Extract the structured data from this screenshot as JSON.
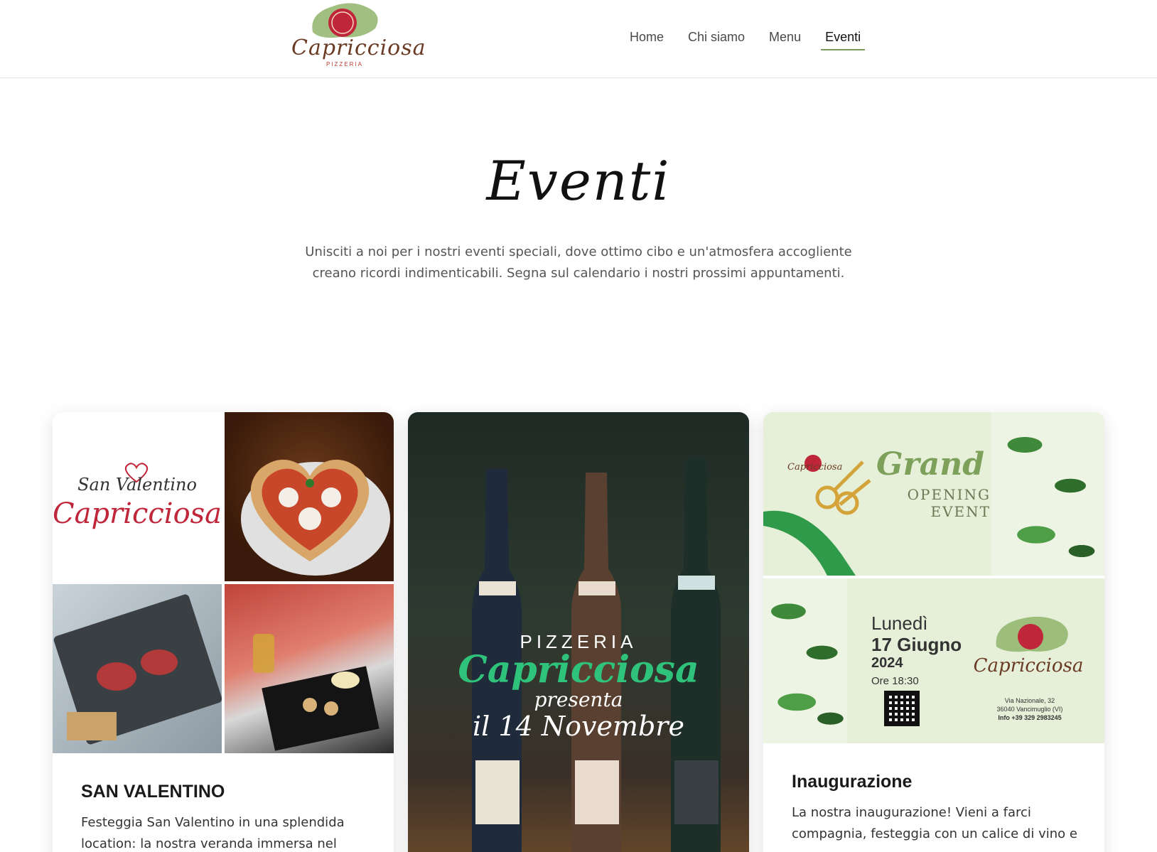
{
  "header": {
    "logo_text": "Capricciosa",
    "logo_sub": "PIZZERIA",
    "nav": [
      {
        "label": "Home",
        "active": false
      },
      {
        "label": "Chi siamo",
        "active": false
      },
      {
        "label": "Menu",
        "active": false
      },
      {
        "label": "Eventi",
        "active": true
      }
    ]
  },
  "page": {
    "title": "Eventi",
    "intro": "Unisciti a noi per i nostri eventi speciali, dove ottimo cibo e un'atmosfera accogliente creano ricordi indimenticabili. Segna sul calendario i nostri prossimi appuntamenti."
  },
  "cards": [
    {
      "title": "SAN VALENTINO",
      "desc": "Festeggia San Valentino in una splendida location: la nostra veranda immersa nel",
      "image_text": {
        "line1": "San Valentino",
        "line2": "Capricciosa"
      }
    },
    {
      "title": "",
      "desc": "",
      "image_text": {
        "line1": "PIZZERIA",
        "line2": "Capricciosa",
        "line3": "presenta",
        "line4": "il 14 Novembre"
      }
    },
    {
      "title": "Inaugurazione",
      "desc": "La nostra inaugurazione! Vieni a farci compagnia, festeggia con un calice di vino e",
      "image_text": {
        "logo": "Capricciosa",
        "grand": "Grand",
        "opening": "OPENING",
        "event": "EVENT",
        "day": "Lunedì",
        "date": "17 Giugno",
        "year": "2024",
        "time": "Ore 18:30",
        "addr1": "Via Nazionale, 32",
        "addr2": "36040 Vancimuglio (VI)",
        "info": "Info +39 329 2983245"
      }
    }
  ]
}
